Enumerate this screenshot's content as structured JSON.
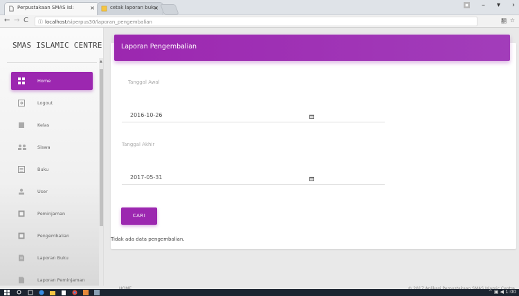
{
  "browser": {
    "tabs": [
      {
        "title": "Perpustakaan SMAS Isl:",
        "active": true
      },
      {
        "title": "cetak laporan buku",
        "active": false
      }
    ],
    "url_host": "localhost",
    "url_path": "/siperpus30/laporan_pengembalian"
  },
  "sidebar": {
    "brand": "SMAS ISLAMIC CENTRE",
    "items": [
      {
        "label": "Home",
        "icon": "dashboard-icon",
        "active": true
      },
      {
        "label": "Logout",
        "icon": "logout-icon"
      },
      {
        "label": "Kelas",
        "icon": "class-icon"
      },
      {
        "label": "Siswa",
        "icon": "students-icon"
      },
      {
        "label": "Buku",
        "icon": "book-icon"
      },
      {
        "label": "User",
        "icon": "user-icon"
      },
      {
        "label": "Peminjaman",
        "icon": "borrow-icon"
      },
      {
        "label": "Pengembalian",
        "icon": "return-icon"
      },
      {
        "label": "Laporan Buku",
        "icon": "report-icon"
      },
      {
        "label": "Laporan Peminjaman",
        "icon": "report-icon"
      }
    ]
  },
  "main": {
    "title": "Laporan Pengembalian",
    "start_label": "Tanggal Awal",
    "start_value": "2016-10-26",
    "end_label": "Tanggal Akhir",
    "end_value": "2017-05-31",
    "search_button": "CARI",
    "empty_message": "Tidak ada data pengembalian."
  },
  "footer": {
    "left": "HOME",
    "right": "© 2017 Aplikasi Perpustakaan SMAS Islamic Centre"
  },
  "colors": {
    "accent": "#9c27b0",
    "sidebar_bg": "#f5f5f5",
    "page_bg": "#e9e9e9"
  }
}
